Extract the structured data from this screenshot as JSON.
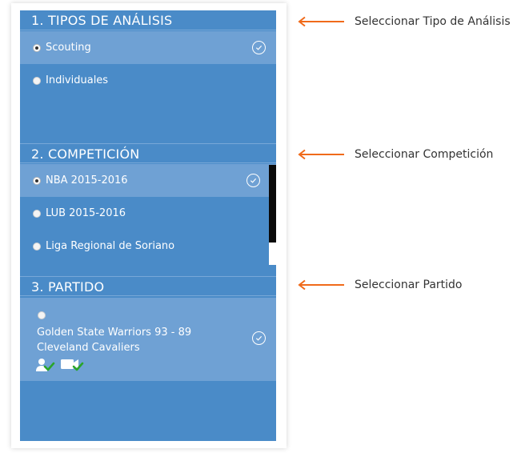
{
  "sections": [
    {
      "title": "1. TIPOS DE ANÁLISIS"
    },
    {
      "title": "2. COMPETICIÓN"
    },
    {
      "title": "3. PARTIDO"
    }
  ],
  "analysis_types": [
    {
      "label": "Scouting",
      "selected": true
    },
    {
      "label": "Individuales",
      "selected": false
    }
  ],
  "competitions": [
    {
      "label": "NBA 2015-2016",
      "selected": true
    },
    {
      "label": "LUB 2015-2016",
      "selected": false
    },
    {
      "label": "Liga Regional de Soriano",
      "selected": false
    }
  ],
  "match": {
    "title": "Golden State Warriors 93 - 89 Cleveland Cavaliers",
    "icons": [
      "user-check-icon",
      "video-check-icon"
    ]
  },
  "annotations": [
    {
      "text": "Seleccionar Tipo de Análisis"
    },
    {
      "text": "Seleccionar Competición"
    },
    {
      "text": "Seleccionar Partido"
    }
  ],
  "colors": {
    "panel": "#4a8bc8",
    "selected_row": "#6fa1d4",
    "arrow": "#f06a1a",
    "check_green": "#2aa52a"
  }
}
